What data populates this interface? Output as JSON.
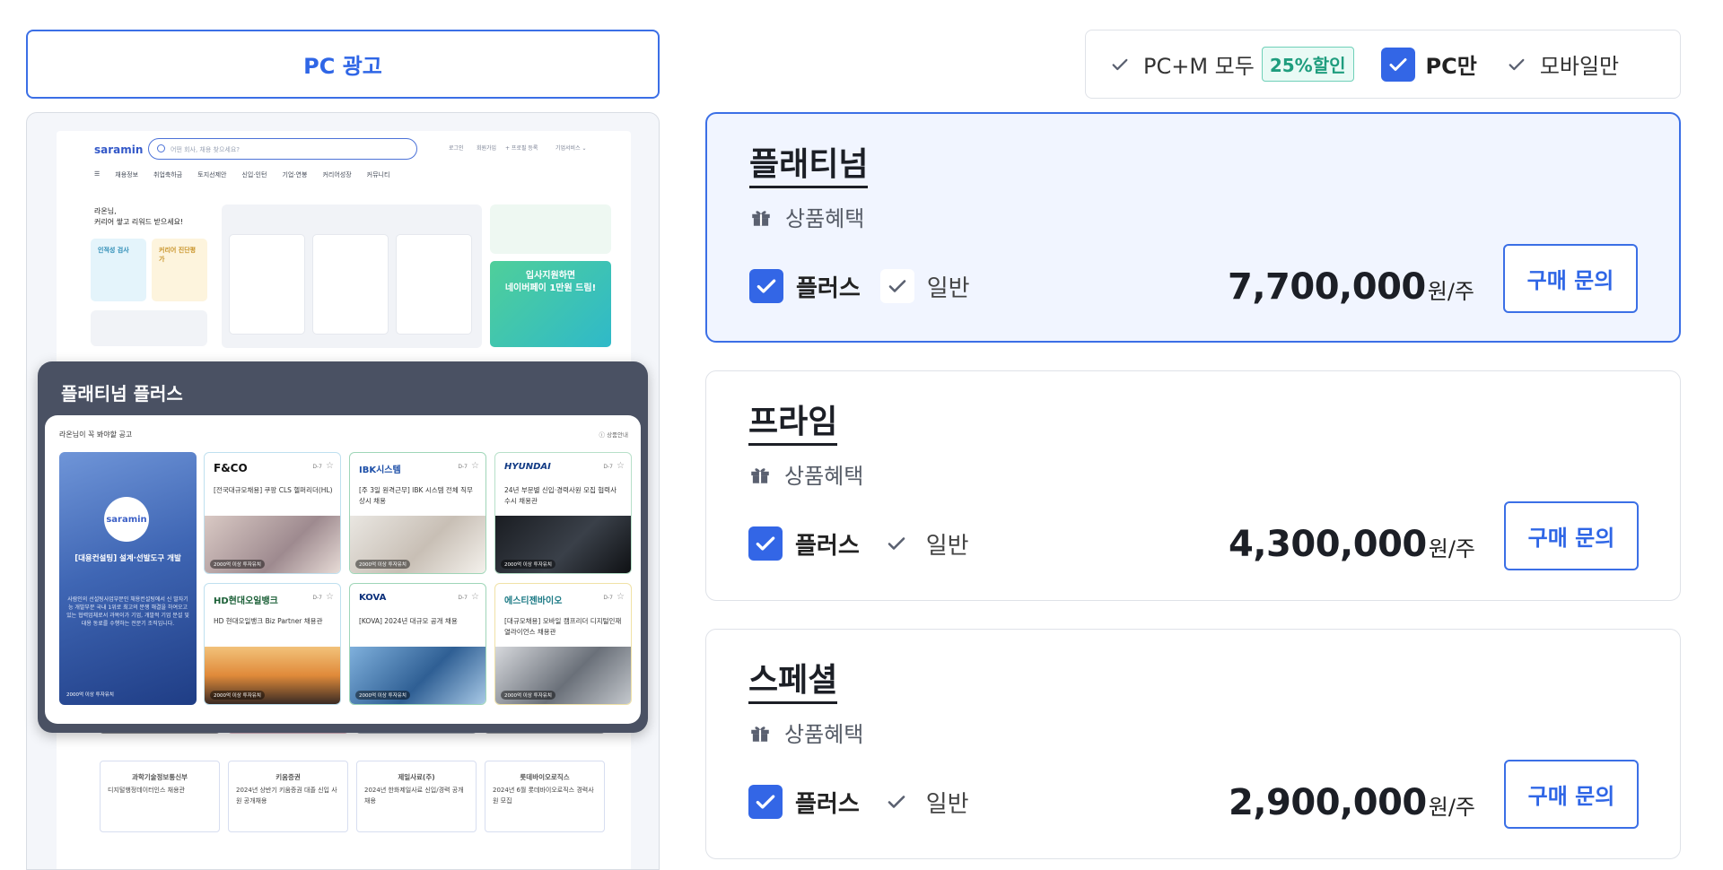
{
  "left": {
    "tab_label": "PC 광고",
    "mock": {
      "logo": "saramin",
      "search_placeholder": "어떤 회사, 채용 찾으세요?",
      "util_links": [
        "로그인",
        "회원가입",
        "+ 프로필 등록",
        "기업서비스 ⌄"
      ],
      "nav_items": [
        "채용정보",
        "취업축하금",
        "토지선제안",
        "신입·인턴",
        "기업·연봉",
        "커리어성장",
        "커뮤니티"
      ],
      "welcome": "라온님,\n커리어 쌓고 리워드 받으세요!",
      "mini_card_1": "인적성 검사",
      "mini_card_2": "커리어 진단평가",
      "banner_text": "입사지원하면\n네이버페이 1만원 드림!",
      "bottom_cards": [
        {
          "company": "과학기술정보통신부",
          "desc": "디지털행정데이터인스 채용관"
        },
        {
          "company": "키움증권",
          "desc": "2024년 상반기 키움증권 대졸 신입 사원 공개채용"
        },
        {
          "company": "제일사료(주)",
          "desc": "2024년 한화제일사료 신입/경력 공개채용"
        },
        {
          "company": "롯데바이오로직스",
          "desc": "2024년 6월 롯데바이오로직스 경력사원 모집"
        }
      ]
    },
    "overlay": {
      "title": "플래티넘 플러스",
      "inner_heading": "라온님이 꼭 봐야할 공고",
      "info_label": "ⓘ 상품안내",
      "big_card": {
        "logo": "saramin",
        "title": "[대용컨설팅] 설계·선발도구 개발",
        "desc": "사람인의 선설팅사업부문인 채용컨설팅에서 신 발자기능 개발부문 국내 1위로 최고의 분쟁 해결을 하여오고 있는 협력업체로서 과목이가 기업, 개발적 기업 분설 및 대용 동료를 수행하는 전문기 조직입니다.",
        "foot": "2000억 이상 투자유치"
      },
      "cards": [
        {
          "logo": "F&CO",
          "dday": "D-7",
          "desc": "[전국대규모채용] 쿠팡 CLS 헬퍼리더(HL)",
          "badge": "2000억 이상 투자유치"
        },
        {
          "logo": "IBK시스템",
          "dday": "D-7",
          "desc": "[주 3일 원격근무] IBK 시스템 전체 직무 상시 채용",
          "badge": "2000억 이상 투자유치"
        },
        {
          "logo": "HYUNDAI",
          "dday": "D-7",
          "desc": "24년 부문별 신입·경력사원 모집 협력사 수시 채용관",
          "badge": "2000억 이상 투자유치"
        },
        {
          "logo": "HD현대오일뱅크",
          "dday": "D-7",
          "desc": "HD 현대오일뱅크 Biz Partner 채용관",
          "badge": "2000억 이상 투자유치"
        },
        {
          "logo": "KOVA",
          "dday": "D-7",
          "desc": "[KOVA] 2024년 대규모 공개 채용",
          "badge": "2000억 이상 투자유치"
        },
        {
          "logo": "에스티젠바이오",
          "dday": "D-7",
          "desc": "[대규모채용] 모바일 캠프리더 디지털인재열라이언스 채용관",
          "badge": "2000억 이상 투자유치"
        }
      ]
    }
  },
  "toggle": {
    "options": [
      {
        "label": "PC+M 모두",
        "selected": false
      },
      {
        "label": "PC만",
        "selected": true
      },
      {
        "label": "모바일만",
        "selected": false
      }
    ],
    "discount": "25%할인",
    "accent": "#3366e6"
  },
  "products": [
    {
      "name": "플래티넘",
      "benefit": "상품혜택",
      "plus": "플러스",
      "normal": "일반",
      "price": "7,700,000",
      "unit": "원/주",
      "button": "구매 문의"
    },
    {
      "name": "프라임",
      "benefit": "상품혜택",
      "plus": "플러스",
      "normal": "일반",
      "price": "4,300,000",
      "unit": "원/주",
      "button": "구매 문의"
    },
    {
      "name": "스페셜",
      "benefit": "상품혜택",
      "plus": "플러스",
      "normal": "일반",
      "price": "2,900,000",
      "unit": "원/주",
      "button": "구매 문의"
    }
  ],
  "icons": {
    "gift": "gift-icon",
    "check": "check-icon"
  }
}
